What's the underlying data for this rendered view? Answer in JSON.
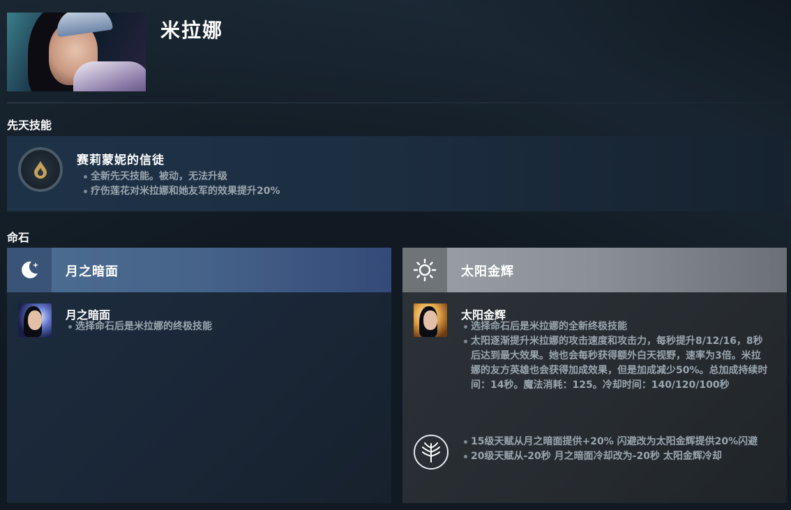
{
  "hero": {
    "name": "米拉娜"
  },
  "innate": {
    "section_title": "先天技能",
    "ability_name": "赛莉蒙妮的信徒",
    "bullets": [
      "全新先天技能。被动，无法升级",
      "疗伤莲花对米拉娜和她友军的效果提升20%"
    ]
  },
  "facets": {
    "section_title": "命石",
    "left": {
      "label": "月之暗面",
      "ability_name": "月之暗面",
      "bullets": [
        "选择命石后是米拉娜的终极技能"
      ]
    },
    "right": {
      "label": "太阳金辉",
      "ability_name": "太阳金辉",
      "bullets": [
        "选择命石后是米拉娜的全新终极技能",
        "太阳逐渐提升米拉娜的攻击速度和攻击力，每秒提升8/12/16，8秒后达到最大效果。她也会每秒获得额外白天视野，速率为3倍。米拉娜的友方英雄也会获得加成效果，但是加成减少50%。总加成持续时间：14秒。魔法消耗：125。冷却时间：140/120/100秒"
      ],
      "talent_bullets": [
        "15级天赋从月之暗面提供+20% 闪避改为太阳金辉提供20%闪避",
        "20级天赋从-20秒 月之暗面冷却改为-20秒 太阳金辉冷却"
      ]
    }
  },
  "colors": {
    "background": "#111a22",
    "moon_header": "#4d6d92",
    "sun_header": "#9aa0a5",
    "bullet_text": "#9aa5ae"
  },
  "icons": {
    "innate": "innate-drop-icon",
    "moon": "moon-stars-icon",
    "sun": "sun-icon",
    "talent": "talent-tree-icon"
  }
}
